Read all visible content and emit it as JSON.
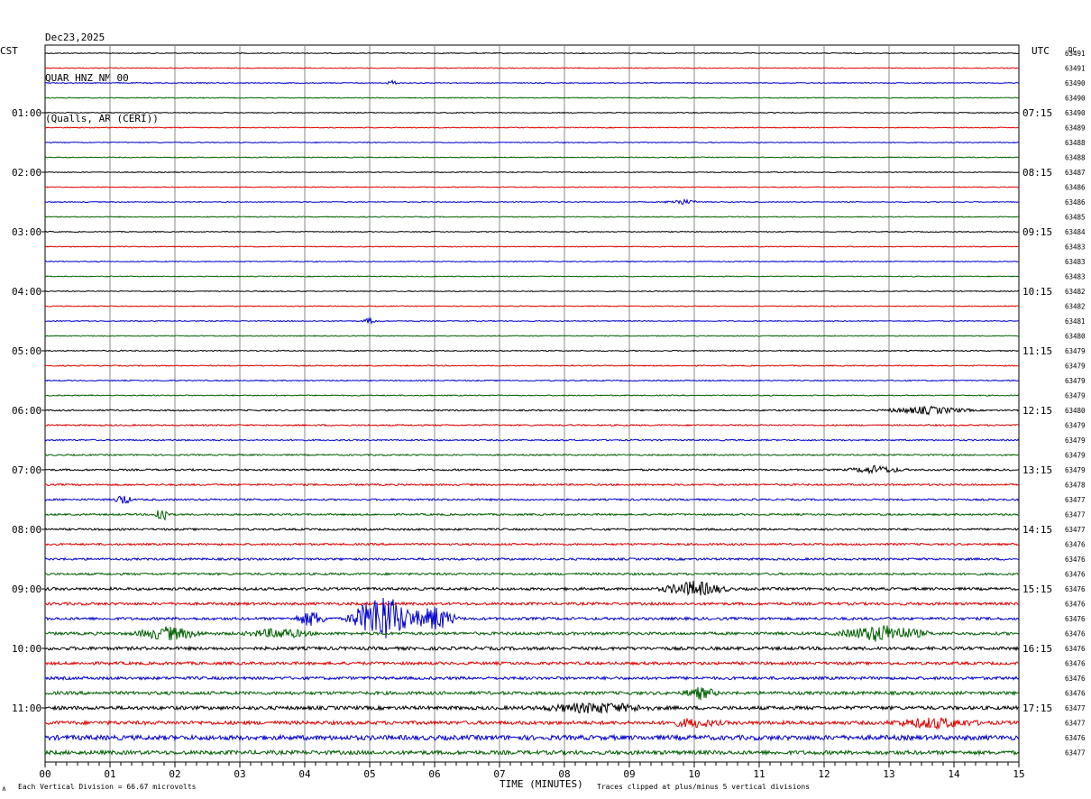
{
  "header": {
    "date": "Dec23,2025",
    "station": "QUAR HNZ NM 00",
    "location": "(Qualls, AR (CERI))"
  },
  "left_tz": "CST",
  "right_tz": "UTC",
  "dc_label": "DC",
  "colors": {
    "trace": [
      "#000000",
      "#e00000",
      "#0000d0",
      "#006000"
    ],
    "grid": "#888888"
  },
  "chart_data": {
    "type": "line",
    "title": "QUAR HNZ NM 00",
    "xlabel": "TIME (MINUTES)",
    "ylabel": "",
    "xlim": [
      0,
      15
    ],
    "x_ticks": [
      "00",
      "01",
      "02",
      "03",
      "04",
      "05",
      "06",
      "07",
      "08",
      "09",
      "10",
      "11",
      "12",
      "13",
      "14",
      "15"
    ],
    "left_hour_labels": [
      "01:00",
      "02:00",
      "03:00",
      "04:00",
      "05:00",
      "06:00",
      "07:00",
      "08:00",
      "09:00",
      "10:00",
      "11:00"
    ],
    "right_hour_labels": [
      "07:15",
      "08:15",
      "09:15",
      "10:15",
      "11:15",
      "12:15",
      "13:15",
      "14:15",
      "15:15",
      "16:15",
      "17:15"
    ],
    "dc_offsets": [
      "63491",
      "63491",
      "63490",
      "63490",
      "63490",
      "63489",
      "63488",
      "63488",
      "63487",
      "63486",
      "63486",
      "63485",
      "63484",
      "63483",
      "63483",
      "63483",
      "63482",
      "63482",
      "63481",
      "63480",
      "63479",
      "63479",
      "63479",
      "63479",
      "63480",
      "63479",
      "63479",
      "63479",
      "63479",
      "63478",
      "63477",
      "63477",
      "63477",
      "63476",
      "63476",
      "63476",
      "63476",
      "63476",
      "63476",
      "63476",
      "63476",
      "63476",
      "63476",
      "63476",
      "63477",
      "63477",
      "63476",
      "63477"
    ],
    "trace_noise": [
      0.5,
      0.5,
      0.5,
      0.5,
      0.5,
      0.5,
      0.5,
      0.5,
      0.5,
      0.5,
      0.5,
      0.5,
      0.5,
      0.5,
      0.5,
      0.5,
      0.5,
      0.5,
      0.5,
      0.5,
      0.6,
      0.6,
      0.6,
      0.6,
      0.8,
      0.8,
      0.8,
      0.8,
      1.0,
      1.0,
      1.0,
      1.0,
      1.1,
      1.1,
      1.2,
      1.2,
      1.5,
      1.5,
      1.5,
      1.6,
      1.8,
      1.6,
      1.6,
      1.8,
      2.0,
      2.0,
      2.6,
      2.2
    ],
    "events": [
      {
        "trace": 2,
        "minute": 5.35,
        "amplitude": 3,
        "duration": 0.1
      },
      {
        "trace": 10,
        "minute": 9.8,
        "amplitude": 3,
        "duration": 0.3
      },
      {
        "trace": 18,
        "minute": 5.0,
        "amplitude": 3,
        "duration": 0.15
      },
      {
        "trace": 24,
        "minute": 13.6,
        "amplitude": 4,
        "duration": 0.8
      },
      {
        "trace": 28,
        "minute": 12.8,
        "amplitude": 4,
        "duration": 0.5
      },
      {
        "trace": 30,
        "minute": 1.2,
        "amplitude": 6,
        "duration": 0.15
      },
      {
        "trace": 31,
        "minute": 1.8,
        "amplitude": 10,
        "duration": 0.15
      },
      {
        "trace": 36,
        "minute": 10.0,
        "amplitude": 8,
        "duration": 0.6
      },
      {
        "trace": 38,
        "minute": 5.2,
        "amplitude": 28,
        "duration": 0.6
      },
      {
        "trace": 38,
        "minute": 6.0,
        "amplitude": 14,
        "duration": 0.4
      },
      {
        "trace": 38,
        "minute": 4.1,
        "amplitude": 8,
        "duration": 0.3
      },
      {
        "trace": 39,
        "minute": 1.9,
        "amplitude": 7,
        "duration": 0.6
      },
      {
        "trace": 39,
        "minute": 12.9,
        "amplitude": 9,
        "duration": 0.8
      },
      {
        "trace": 39,
        "minute": 3.6,
        "amplitude": 5,
        "duration": 0.6
      },
      {
        "trace": 43,
        "minute": 10.1,
        "amplitude": 6,
        "duration": 0.3
      },
      {
        "trace": 44,
        "minute": 8.5,
        "amplitude": 5,
        "duration": 1.0
      },
      {
        "trace": 45,
        "minute": 13.7,
        "amplitude": 5,
        "duration": 0.8
      },
      {
        "trace": 45,
        "minute": 10.0,
        "amplitude": 4,
        "duration": 0.5
      }
    ]
  },
  "footer": {
    "left_mark": "∧",
    "scale_text": "Each Vertical Division =   66.67 microvolts",
    "xlabel": "TIME (MINUTES)",
    "clip_text": "Traces clipped at plus/minus 5 vertical divisions"
  }
}
